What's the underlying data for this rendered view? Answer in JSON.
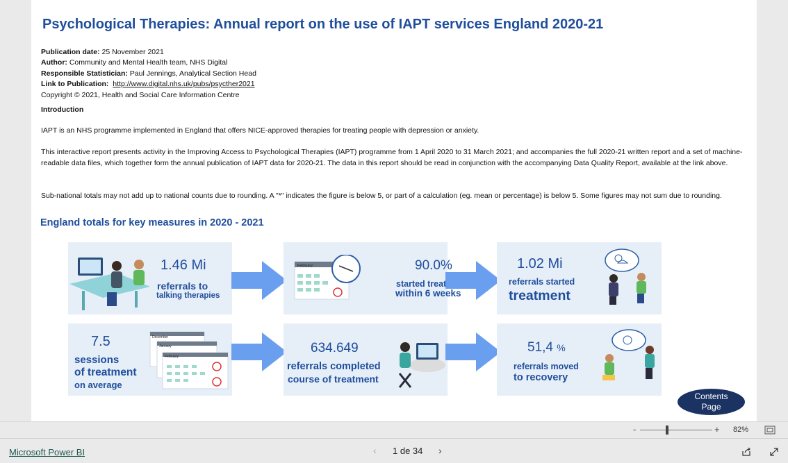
{
  "report": {
    "title": "Psychological Therapies: Annual report on the use of IAPT services England 2020-21",
    "publication_date_label": "Publication date:",
    "publication_date": "25 November 2021",
    "author_label": "Author:",
    "author": "Community and Mental Health team, NHS Digital",
    "statistician_label": "Responsible Statistician:",
    "statistician": "Paul Jennings, Analytical Section Head",
    "link_label": "Link to Publication:",
    "link": "http://www.digital.nhs.uk/pubs/psycther2021",
    "copyright": "Copyright © 2021, Health and Social Care Information Centre",
    "intro_heading": "Introduction",
    "intro_p1": "IAPT is an NHS programme implemented in England that offers NICE-approved therapies for treating people with depression or anxiety.",
    "intro_p2": "This interactive report presents activity in the Improving Access to Psychological Therapies (IAPT) programme from 1 April 2020 to 31 March 2021; and accompanies the full 2020-21 written report and a set of machine-readable data files, which together form the annual publication of IAPT data for 2020-21. The data in this report should be read in conjunction with the accompanying Data Quality Report, available at the link above.",
    "intro_p3": "Sub-national totals may not add up to national counts due to rounding. A \"*\" indicates the figure is below 5, or part of a calculation (eg. mean or percentage) is below 5. Some figures may not sum due to rounding.",
    "section_title": "England totals for key measures in 2020 - 2021"
  },
  "cards": {
    "referrals_value": "1.46 Mi",
    "referrals_line1": "referrals to",
    "referrals_line2": "talking therapies",
    "six_weeks_value": "90.0%",
    "six_weeks_line1": "started treatment",
    "six_weeks_line2": "within 6 weeks",
    "calendar_month": "February",
    "started_value": "1.02 Mi",
    "started_line1": "referrals started",
    "started_line2": "treatment",
    "sessions_value": "7.5",
    "sessions_line1": "sessions",
    "sessions_line2": "of treatment",
    "sessions_line3": "on average",
    "cal_december": "December",
    "cal_january": "January",
    "cal_february": "February",
    "completed_value": "634.649",
    "completed_line1": "referrals completed",
    "completed_line2": "course of treatment",
    "recovery_value": "51,4",
    "recovery_pct": "%",
    "recovery_line1": "referrals moved",
    "recovery_line2": "to recovery"
  },
  "contents_button": {
    "line1": "Contents",
    "line2": "Page"
  },
  "zoom": {
    "minus": "-",
    "plus": "+",
    "level": "82%"
  },
  "footer": {
    "app_link": "Microsoft Power BI",
    "page_indicator": "1 de 34"
  },
  "colors": {
    "title_blue": "#1f4e9c",
    "card_bg": "#e6eef8",
    "arrow_blue": "#6a9ff0",
    "button_navy": "#1b3363"
  }
}
